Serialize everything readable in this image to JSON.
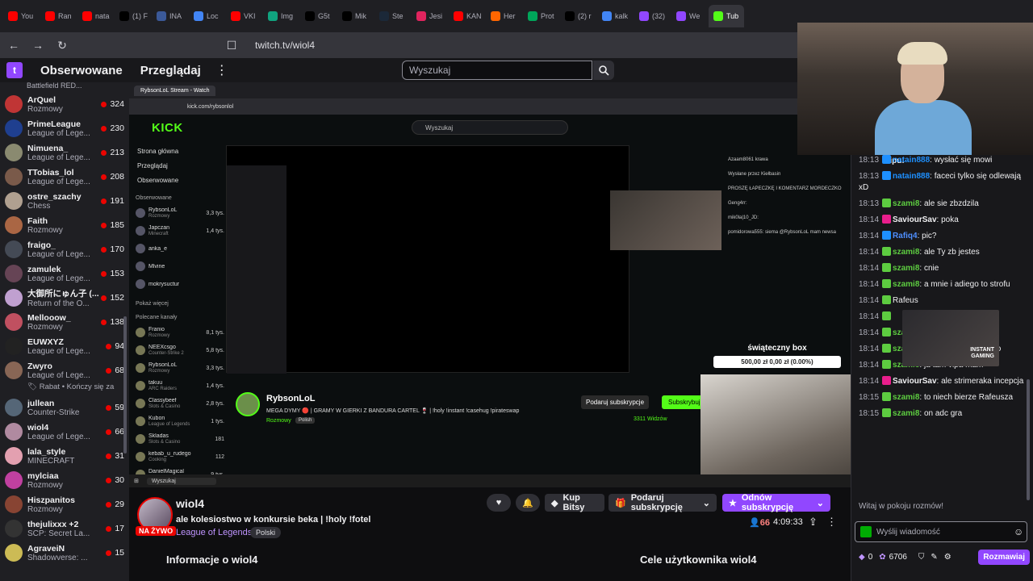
{
  "browser": {
    "tabs": [
      {
        "label": "You",
        "color": "#ff0000"
      },
      {
        "label": "Ran",
        "color": "#ff0000"
      },
      {
        "label": "nata",
        "color": "#ff0000"
      },
      {
        "label": "(1) F",
        "color": "#000000"
      },
      {
        "label": "INA",
        "color": "#3b5998"
      },
      {
        "label": "Loc",
        "color": "#4285f4"
      },
      {
        "label": "VKI",
        "color": "#ff0000"
      },
      {
        "label": "Img",
        "color": "#10a37f"
      },
      {
        "label": "G5t",
        "color": "#000000"
      },
      {
        "label": "Mik",
        "color": "#000000"
      },
      {
        "label": "Ste",
        "color": "#1b2838"
      },
      {
        "label": "Jesi",
        "color": "#e0245e"
      },
      {
        "label": "KAN",
        "color": "#ff0000"
      },
      {
        "label": "Her",
        "color": "#ff6600"
      },
      {
        "label": "Prot",
        "color": "#00a65a"
      },
      {
        "label": "(2) r",
        "color": "#000000"
      },
      {
        "label": "kalk",
        "color": "#4285f4"
      },
      {
        "label": "(32)",
        "color": "#9147ff"
      },
      {
        "label": "We",
        "color": "#9147ff"
      },
      {
        "label": "Tub",
        "color": "#53fc18"
      }
    ],
    "url": "twitch.tv/wiol4"
  },
  "topnav": {
    "followed": "Obserwowane",
    "browse": "Przeglądaj",
    "search_placeholder": "Wyszukaj"
  },
  "sidebar": {
    "header": "Battlefield RED...",
    "channels": [
      {
        "name": "ArQuel",
        "game": "Rozmowy",
        "viewers": "324",
        "color": "#c03535"
      },
      {
        "name": "PrimeLeague",
        "game": "League of Lege...",
        "viewers": "230",
        "color": "#1f3f8f"
      },
      {
        "name": "Nimuena_",
        "game": "League of Lege...",
        "viewers": "213",
        "color": "#8a8a70"
      },
      {
        "name": "TTobias_lol",
        "game": "League of Lege...",
        "viewers": "208",
        "color": "#7a5a4a"
      },
      {
        "name": "ostre_szachy",
        "game": "Chess",
        "viewers": "191",
        "color": "#b0a090"
      },
      {
        "name": "Faith",
        "game": "Rozmowy",
        "viewers": "185",
        "color": "#aa6644"
      },
      {
        "name": "fraigo_",
        "game": "League of Lege...",
        "viewers": "170",
        "color": "#444a55"
      },
      {
        "name": "zamulek",
        "game": "League of Lege...",
        "viewers": "153",
        "color": "#664455"
      },
      {
        "name": "大御所にゅん子 (...",
        "game": "Return of the O...",
        "viewers": "152",
        "color": "#c0a0d0"
      },
      {
        "name": "Mellooow_",
        "game": "Rozmowy",
        "viewers": "138",
        "color": "#c05060"
      },
      {
        "name": "EUWXYZ",
        "game": "League of Lege...",
        "viewers": "94",
        "color": "#222222"
      },
      {
        "name": "Zwyro",
        "game": "League of Lege...",
        "viewers": "68",
        "color": "#886655"
      }
    ],
    "banner": "Rabat • Kończy się za",
    "channels2": [
      {
        "name": "jullean",
        "game": "Counter-Strike",
        "viewers": "59",
        "color": "#556677"
      },
      {
        "name": "wiol4",
        "game": "League of Lege...",
        "viewers": "66",
        "color": "#b08aa0"
      },
      {
        "name": "lala_style",
        "game": "MINECRAFT",
        "viewers": "31",
        "color": "#e3a0b0"
      },
      {
        "name": "mylciaa",
        "game": "Rozmowy",
        "viewers": "30",
        "color": "#c040a0"
      },
      {
        "name": "Hiszpanitos",
        "game": "Rozmowy",
        "viewers": "29",
        "color": "#884433"
      },
      {
        "name": "thejulixxx +2",
        "game": "SCP: Secret La...",
        "viewers": "17",
        "color": "#333333"
      },
      {
        "name": "AgraveiN",
        "game": "Shadowverse: ...",
        "viewers": "15",
        "color": "#ccbb55"
      }
    ]
  },
  "kick": {
    "tab_label": "RybsonLoL Stream - Watch",
    "url": "kick.com/rybsonlol",
    "logo": "KICK",
    "search": "Wyszukaj",
    "links": [
      "Strona główna",
      "Przeglądaj",
      "Obserwowane"
    ],
    "section_followed": "Obserwowane",
    "followed": [
      {
        "name": "RybsonLoL",
        "game": "Rozmowy",
        "viewers": "3,3 tys."
      },
      {
        "name": "Japczan",
        "game": "Minecraft",
        "viewers": "1,4 tys."
      },
      {
        "name": "anka_e",
        "game": "",
        "viewers": ""
      },
      {
        "name": "Mlvine",
        "game": "",
        "viewers": ""
      },
      {
        "name": "mokrysuctur",
        "game": "",
        "viewers": ""
      }
    ],
    "show_more": "Pokaż więcej",
    "section_recommended": "Polecane kanały",
    "recommended": [
      {
        "name": "Franio",
        "game": "Rozmowy",
        "viewers": "8,1 tys."
      },
      {
        "name": "NEEXcsgo",
        "game": "Counter-Strike 2",
        "viewers": "5,8 tys."
      },
      {
        "name": "RybsonLoL",
        "game": "Rozmowy",
        "viewers": "3,3 tys."
      },
      {
        "name": "takuu",
        "game": "ARC Raiders",
        "viewers": "1,4 tys."
      },
      {
        "name": "Classybeef",
        "game": "Slots & Casino",
        "viewers": "2,8 tys."
      },
      {
        "name": "Kubon",
        "game": "League of Legends",
        "viewers": "1 tys."
      },
      {
        "name": "Skladas",
        "game": "Slots & Casino",
        "viewers": "181"
      },
      {
        "name": "kebab_u_rudego",
        "game": "Cooking",
        "viewers": "112"
      },
      {
        "name": "DanielMagical",
        "game": "IRL",
        "viewers": "9 tys."
      }
    ],
    "streamer": "RybsonLoL",
    "title": "MEGA DYMY 🔴 | GRAMY W GIERKI Z BANDURA CARTEL 🍷 | !holy !instant !casehug !pirateswap",
    "category": "Rozmowy",
    "language": "Polish",
    "gift_sub": "Podaruj subskrypcje",
    "subscribe": "Subskrybuj",
    "viewers": "3311 Widzów",
    "chat_label": "Czat",
    "chat_lines": [
      "Azaam8061 krawa",
      "Wysłane przez Kiełbasin",
      "PROSZĘ ŁAPECZKĘ I KOMENTARZ MORDECZKO",
      "Geng4rr:",
      "mik0la|10_JD:",
      "pomidorowa555: siema @RybsonLoL mam newsa"
    ],
    "sub_title": "świąteczny box",
    "sub_amount": "500,00 zł  0,00 zł (0.00%)",
    "taskbar_search": "Wyszukaj",
    "nested_info": "Informacje o wiol4",
    "nested_goals": "Cele użytkownika wiol4"
  },
  "stream": {
    "name": "wiol4",
    "live_badge": "NA ŻYWO",
    "title": "ale kolesiostwo w konkursie beka | !holy !fotel",
    "category": "League of Legends",
    "tag": "Polski",
    "bits": "Kup Bitsy",
    "gift": "Podaruj subskrypcję",
    "renew": "Odnów subskrypcję",
    "viewers": "66",
    "uptime": "4:09:33",
    "about": "Informacje o wiol4",
    "goals": "Cele użytkownika wiol4"
  },
  "chat": {
    "clip_text": "klipu!",
    "messages": [
      {
        "time": "18:13",
        "user": "natain888",
        "text": ": wysłać się mowi",
        "cls": "u1"
      },
      {
        "time": "18:13",
        "user": "natain888",
        "text": ": faceci tylko się odlewają xD",
        "cls": "u1"
      },
      {
        "time": "18:13",
        "user": "szami8",
        "text": ": ale sie zbzdzila",
        "cls": "u2"
      },
      {
        "time": "18:14",
        "user": "SaviourSav",
        "text": ": poka",
        "cls": "u3"
      },
      {
        "time": "18:14",
        "user": "Rafiq4",
        "text": ": pic?",
        "cls": "u4"
      },
      {
        "time": "18:14",
        "user": "szami8",
        "text": ": ale Ty zb jestes",
        "cls": "u2"
      },
      {
        "time": "18:14",
        "user": "szami8",
        "text": ": cnie",
        "cls": "u2"
      },
      {
        "time": "18:14",
        "user": "szami8",
        "text": ": a mnie i adiego to strofu",
        "cls": "u2"
      },
      {
        "time": "18:14",
        "user": "",
        "text": "Rafeus",
        "cls": "u2"
      },
      {
        "time": "18:14",
        "user": "",
        "text": "",
        "cls": "u2"
      },
      {
        "time": "18:14",
        "user": "szami8",
        "text": ": XD",
        "cls": "u2"
      },
      {
        "time": "18:14",
        "user": "szami8",
        "text": ": jak Raffi to mój ziomo",
        "cls": "u2"
      },
      {
        "time": "18:14",
        "user": "szami8",
        "text": ": ja tam vipa mam",
        "cls": "u2"
      },
      {
        "time": "18:14",
        "user": "SaviourSav",
        "text": ": ale strimeraka incepcja",
        "cls": "u3"
      },
      {
        "time": "18:15",
        "user": "szami8",
        "text": ": to niech bierze Rafeusza",
        "cls": "u2"
      },
      {
        "time": "18:15",
        "user": "szami8",
        "text": ": on adc gra",
        "cls": "u2"
      }
    ],
    "sponsor_line1": "INSTANT",
    "sponsor_line2": "GAMING",
    "welcome": "Witaj w pokoju rozmów!",
    "input_placeholder": "Wyślij wiadomość",
    "bits": "0",
    "points": "6706",
    "send": "Rozmawiaj"
  }
}
